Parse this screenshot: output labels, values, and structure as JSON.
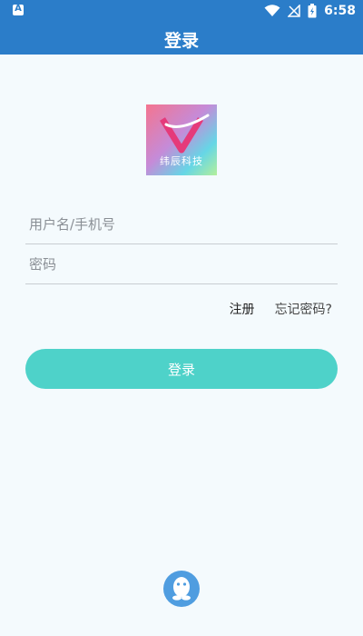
{
  "status_bar": {
    "time": "6:58",
    "icons": [
      "app-notification-icon",
      "wifi-icon",
      "no-signal-icon",
      "battery-charging-icon"
    ]
  },
  "header": {
    "title": "登录"
  },
  "logo": {
    "caption": "纬辰科技"
  },
  "form": {
    "username_placeholder": "用户名/手机号",
    "password_placeholder": "密码"
  },
  "links": {
    "register_label": "注册",
    "forgot_password_label": "忘记密码?"
  },
  "login_button_label": "登录",
  "social_login": {
    "icon": "qq-icon"
  },
  "colors": {
    "primary_bar": "#2b7dc9",
    "accent_button": "#4ed2c9",
    "background": "#f4fafd"
  }
}
